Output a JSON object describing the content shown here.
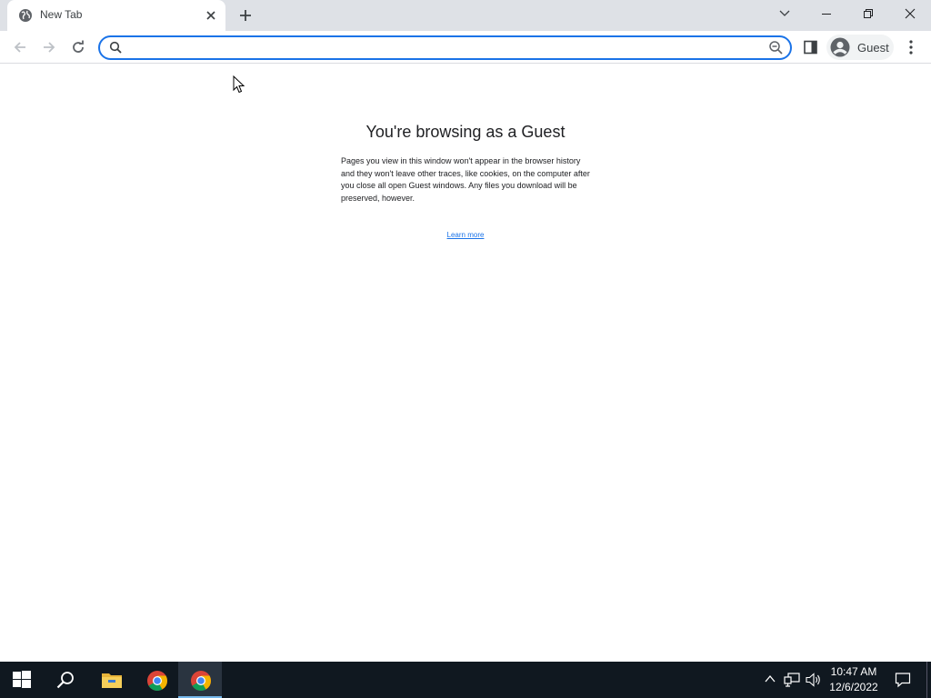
{
  "browser": {
    "tab": {
      "title": "New Tab",
      "favicon": "globe-icon",
      "close_icon": "close-icon"
    },
    "new_tab_icon": "plus-icon",
    "window_controls": [
      "tab-search-chevron-icon",
      "minimize-icon",
      "restore-icon",
      "close-icon"
    ],
    "toolbar": {
      "back_icon": "back-arrow-icon",
      "forward_icon": "forward-arrow-icon",
      "reload_icon": "reload-icon",
      "omnibox": {
        "value": "",
        "placeholder": "",
        "search_icon": "search-icon",
        "zoom_icon": "zoom-out-icon"
      },
      "side_panel_icon": "side-panel-icon",
      "profile": {
        "label": "Guest",
        "avatar_icon": "person-icon"
      },
      "menu_icon": "three-dot-menu-icon"
    }
  },
  "page": {
    "heading": "You're browsing as a Guest",
    "body": "Pages you view in this window won't appear in the browser history and they won't leave other traces, like cookies, on the computer after you close all open Guest windows. Any files you download will be preserved, however.",
    "learn_more": "Learn more"
  },
  "taskbar": {
    "apps": [
      "windows-start-icon",
      "search-icon",
      "file-explorer-icon",
      "chrome-icon",
      "chrome-icon"
    ],
    "tray": {
      "icons": [
        "chevron-up-icon",
        "network-icon",
        "volume-icon"
      ],
      "time": "10:47 AM",
      "date": "12/6/2022"
    }
  },
  "colors": {
    "accent": "#1a73e8",
    "tabstrip": "#dee1e6",
    "taskbar": "#101820"
  }
}
